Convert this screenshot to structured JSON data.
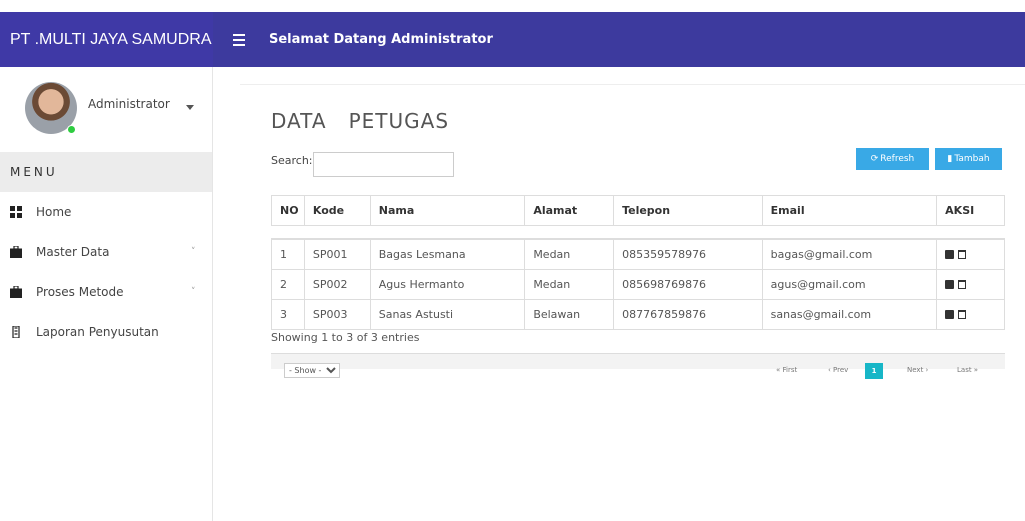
{
  "app": {
    "brand": "PT .MULTI JAYA SAMUDRA",
    "welcome": "Selamat Datang Administrator",
    "accent": "#3d3a9e"
  },
  "profile": {
    "name": "Administrator"
  },
  "sidebar": {
    "menu_label": "MENU",
    "items": [
      {
        "label": "Home",
        "icon": "grid-icon"
      },
      {
        "label": "Master Data",
        "icon": "briefcase-icon"
      },
      {
        "label": "Proses Metode",
        "icon": "briefcase-icon"
      },
      {
        "label": "Laporan Penyusutan",
        "icon": "file-icon"
      }
    ]
  },
  "page": {
    "title": "DATA   PETUGAS"
  },
  "search": {
    "label": "Search:",
    "value": ""
  },
  "toolbar": {
    "refresh": "Refresh",
    "add": "Tambah",
    "button_color": "#39a9e6"
  },
  "table": {
    "headers": [
      "NO",
      "Kode",
      "Nama",
      "Alamat",
      "Telepon",
      "Email",
      "AKSI"
    ],
    "rows": [
      [
        "1",
        "SP001",
        "Bagas Lesmana",
        "Medan",
        "085359578976",
        "bagas@gmail.com"
      ],
      [
        "2",
        "SP002",
        "Agus Hermanto",
        "Medan",
        "085698769876",
        "agus@gmail.com"
      ],
      [
        "3",
        "SP003",
        "Sanas Astusti",
        "Belawan",
        "087767859876",
        "sanas@gmail.com"
      ]
    ]
  },
  "footer": {
    "showing": "Showing 1 to 3 of 3 entries",
    "show_select": "- Show -",
    "pager": {
      "first": "« First",
      "prev": "‹ Prev",
      "current": "1",
      "next": "Next ›",
      "last": "Last »"
    }
  }
}
